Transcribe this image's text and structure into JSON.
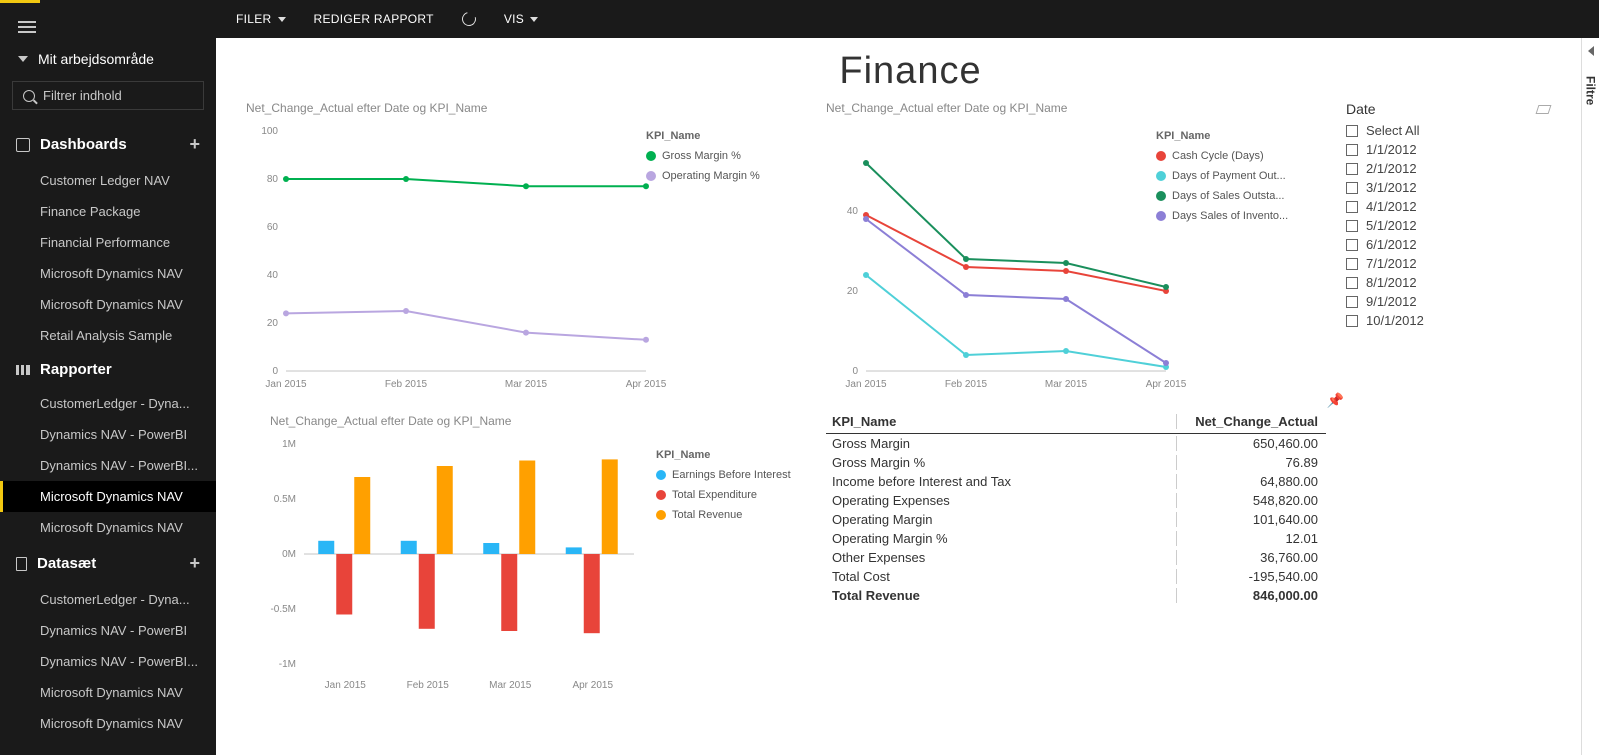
{
  "workspace": "Mit arbejdsområde",
  "filter_placeholder": "Filtrer indhold",
  "toolbar": {
    "filer": "FILER",
    "rediger": "REDIGER RAPPORT",
    "vis": "VIS"
  },
  "sections": {
    "dashboards": {
      "title": "Dashboards",
      "items": [
        "Customer Ledger NAV",
        "Finance Package",
        "Financial Performance",
        "Microsoft Dynamics NAV",
        "Microsoft Dynamics NAV",
        "Retail Analysis Sample"
      ]
    },
    "rapporter": {
      "title": "Rapporter",
      "items": [
        "CustomerLedger - Dyna...",
        "Dynamics NAV - PowerBI",
        "Dynamics NAV - PowerBI...",
        "Microsoft Dynamics NAV",
        "Microsoft Dynamics NAV"
      ],
      "active_index": 3
    },
    "datasaet": {
      "title": "Datasæt",
      "items": [
        "CustomerLedger - Dyna...",
        "Dynamics NAV - PowerBI",
        "Dynamics NAV - PowerBI...",
        "Microsoft Dynamics NAV",
        "Microsoft Dynamics NAV"
      ]
    }
  },
  "report_title": "Finance",
  "right_rail": "Filtre",
  "slicer": {
    "title": "Date",
    "options": [
      "Select All",
      "1/1/2012",
      "2/1/2012",
      "3/1/2012",
      "4/1/2012",
      "5/1/2012",
      "6/1/2012",
      "7/1/2012",
      "8/1/2012",
      "9/1/2012",
      "10/1/2012"
    ]
  },
  "table": {
    "headers": [
      "KPI_Name",
      "Net_Change_Actual"
    ],
    "rows": [
      [
        "Gross Margin",
        "650,460.00"
      ],
      [
        "Gross Margin %",
        "76.89"
      ],
      [
        "Income before Interest and Tax",
        "64,880.00"
      ],
      [
        "Operating Expenses",
        "548,820.00"
      ],
      [
        "Operating Margin",
        "101,640.00"
      ],
      [
        "Operating Margin %",
        "12.01"
      ],
      [
        "Other Expenses",
        "36,760.00"
      ],
      [
        "Total Cost",
        "-195,540.00"
      ],
      [
        "Total Revenue",
        "846,000.00"
      ]
    ]
  },
  "chart_data": [
    {
      "id": "chart1",
      "type": "line",
      "title": "Net_Change_Actual efter Date og KPI_Name",
      "legend_title": "KPI_Name",
      "categories": [
        "Jan 2015",
        "Feb 2015",
        "Mar 2015",
        "Apr 2015"
      ],
      "ylim": [
        0,
        100
      ],
      "y_ticks": [
        0,
        20,
        40,
        60,
        80,
        100
      ],
      "series": [
        {
          "name": "Gross Margin %",
          "color": "#00B050",
          "values": [
            80,
            80,
            77,
            77
          ]
        },
        {
          "name": "Operating Margin %",
          "color": "#B9A6E0",
          "values": [
            24,
            25,
            16,
            13
          ]
        }
      ]
    },
    {
      "id": "chart2",
      "type": "line",
      "title": "Net_Change_Actual efter Date og KPI_Name",
      "legend_title": "KPI_Name",
      "categories": [
        "Jan 2015",
        "Feb 2015",
        "Mar 2015",
        "Apr 2015"
      ],
      "ylim": [
        0,
        60
      ],
      "y_ticks": [
        0,
        20,
        40
      ],
      "series": [
        {
          "name": "Cash Cycle (Days)",
          "color": "#E8443A",
          "values": [
            39,
            26,
            25,
            20
          ]
        },
        {
          "name": "Days of Payment Out...",
          "color": "#4FD0D8",
          "values": [
            24,
            4,
            5,
            1
          ]
        },
        {
          "name": "Days of Sales Outsta...",
          "color": "#1A8F5C",
          "values": [
            52,
            28,
            27,
            21
          ]
        },
        {
          "name": "Days Sales of Invento...",
          "color": "#8C7FD6",
          "values": [
            38,
            19,
            18,
            2
          ]
        }
      ]
    },
    {
      "id": "chart3",
      "type": "bar",
      "title": "Net_Change_Actual efter Date og KPI_Name",
      "legend_title": "KPI_Name",
      "categories": [
        "Jan 2015",
        "Feb 2015",
        "Mar 2015",
        "Apr 2015"
      ],
      "ylim": [
        -1000000,
        1000000
      ],
      "y_ticks": [
        "-1M",
        "-0.5M",
        "0M",
        "0.5M",
        "1M"
      ],
      "series": [
        {
          "name": "Earnings Before Interest",
          "color": "#29B6F6",
          "values": [
            120000,
            120000,
            100000,
            60000
          ]
        },
        {
          "name": "Total Expenditure",
          "color": "#E8443A",
          "values": [
            -550000,
            -680000,
            -700000,
            -720000
          ]
        },
        {
          "name": "Total Revenue",
          "color": "#FFA000",
          "values": [
            700000,
            800000,
            850000,
            860000
          ]
        }
      ]
    }
  ]
}
